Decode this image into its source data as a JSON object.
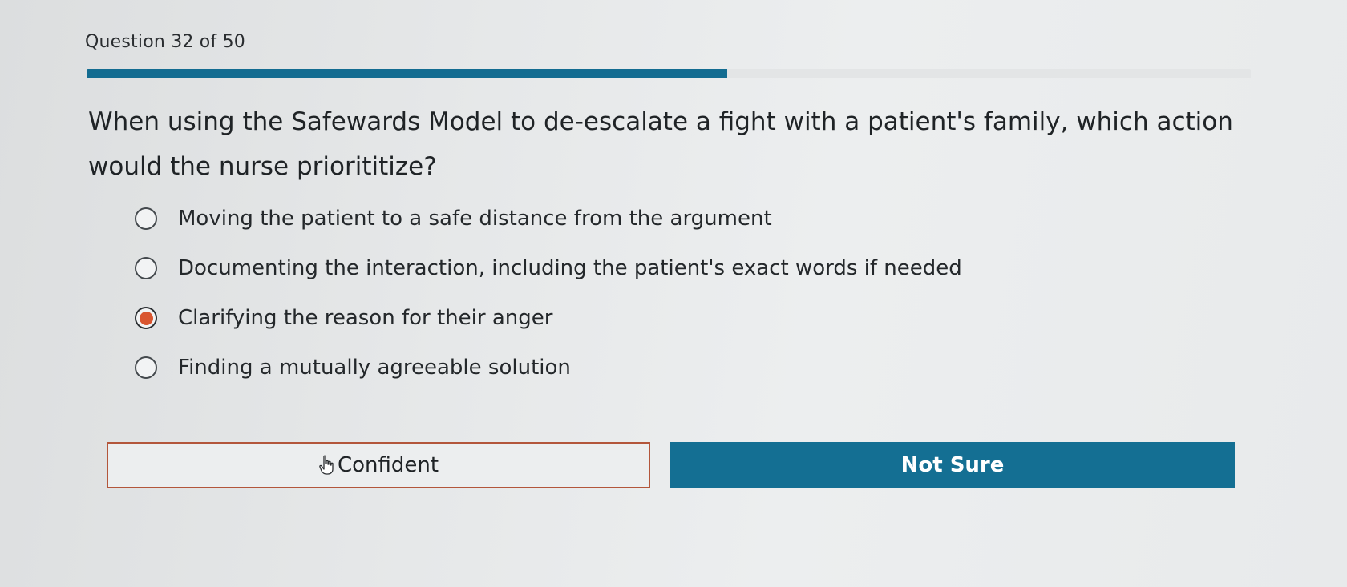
{
  "header": {
    "counter": "Question 32 of 50"
  },
  "progress": {
    "fraction": 0.55,
    "fill_color": "#136c91"
  },
  "question": {
    "text": "When using the Safewards Model to de-escalate a fight with a patient's family, which action would the nurse priorititize?"
  },
  "options": [
    {
      "label": "Moving the patient to a safe distance from the argument",
      "selected": false
    },
    {
      "label": "Documenting the interaction, including the patient's exact words if needed",
      "selected": false
    },
    {
      "label": "Clarifying the reason for their anger",
      "selected": true
    },
    {
      "label": "Finding a mutually agreeable solution",
      "selected": false
    }
  ],
  "buttons": {
    "confident_label": "Confident",
    "not_sure_label": "Not Sure"
  },
  "colors": {
    "accent": "#146f93",
    "selected_radio": "#d9552f",
    "confident_border": "#b3563b"
  },
  "icons": {
    "pointer": "hand-pointer-icon"
  }
}
